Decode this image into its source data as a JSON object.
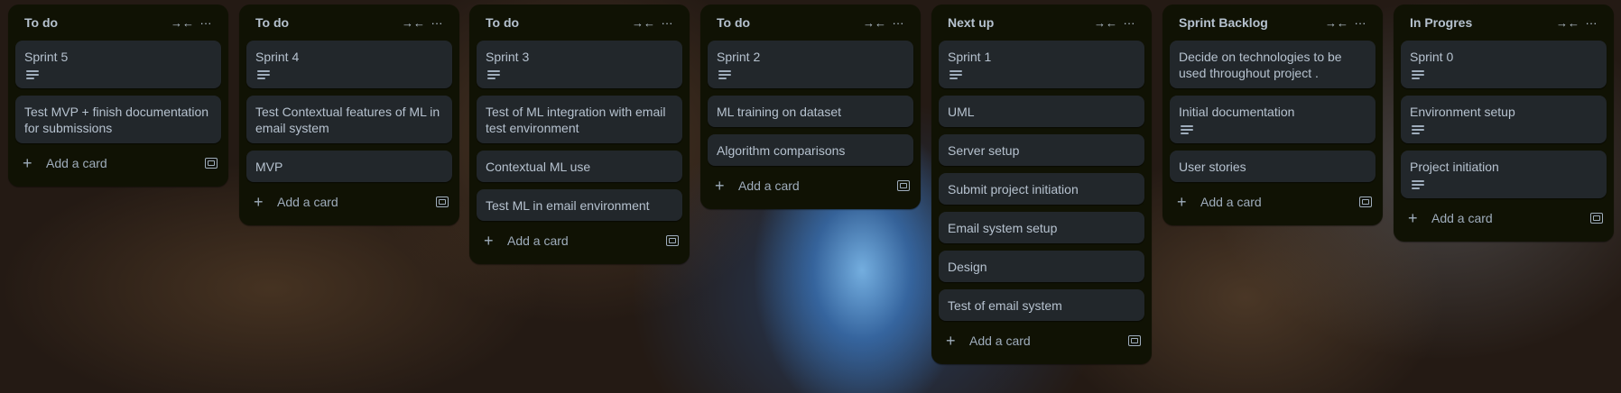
{
  "colors": {
    "list_bg": "#101204",
    "card_bg": "#22272b",
    "text": "#b6c2cf"
  },
  "icons": {
    "collapse": "collapse-arrows-icon",
    "more": "more-dots-icon",
    "add": "plus-icon",
    "template": "card-template-icon",
    "description": "description-lines-icon"
  },
  "add_card_label": "Add a card",
  "lists": [
    {
      "title": "To do",
      "cards": [
        {
          "text": "Sprint 5",
          "has_desc": true
        },
        {
          "text": "Test MVP + finish documentation for submissions",
          "has_desc": false
        }
      ]
    },
    {
      "title": "To do",
      "cards": [
        {
          "text": "Sprint 4",
          "has_desc": true
        },
        {
          "text": "Test Contextual features of ML in email system",
          "has_desc": false
        },
        {
          "text": "MVP",
          "has_desc": false
        }
      ]
    },
    {
      "title": "To do",
      "cards": [
        {
          "text": "Sprint 3",
          "has_desc": true
        },
        {
          "text": "Test of ML integration with email test environment",
          "has_desc": false
        },
        {
          "text": "Contextual ML use",
          "has_desc": false
        },
        {
          "text": "Test ML in email environment",
          "has_desc": false
        }
      ]
    },
    {
      "title": "To do",
      "cards": [
        {
          "text": "Sprint 2",
          "has_desc": true
        },
        {
          "text": "ML training on dataset",
          "has_desc": false
        },
        {
          "text": "Algorithm comparisons",
          "has_desc": false
        }
      ]
    },
    {
      "title": "Next up",
      "cards": [
        {
          "text": "Sprint 1",
          "has_desc": true
        },
        {
          "text": "UML",
          "has_desc": false
        },
        {
          "text": "Server setup",
          "has_desc": false
        },
        {
          "text": "Submit project initiation",
          "has_desc": false
        },
        {
          "text": "Email system setup",
          "has_desc": false
        },
        {
          "text": "Design",
          "has_desc": false
        },
        {
          "text": "Test of email system",
          "has_desc": false
        }
      ]
    },
    {
      "title": "Sprint Backlog",
      "cards": [
        {
          "text": "Decide on technologies to be used throughout project .",
          "has_desc": false
        },
        {
          "text": "Initial documentation",
          "has_desc": true
        },
        {
          "text": "User stories",
          "has_desc": false
        }
      ]
    },
    {
      "title": "In Progres",
      "cards": [
        {
          "text": "Sprint 0",
          "has_desc": true
        },
        {
          "text": "Environment setup",
          "has_desc": true
        },
        {
          "text": "Project initiation",
          "has_desc": true
        }
      ]
    }
  ]
}
